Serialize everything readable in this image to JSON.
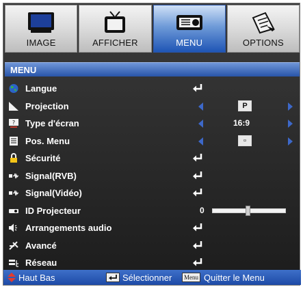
{
  "tabs": [
    {
      "label": "IMAGE",
      "icon": "monitor-icon",
      "active": false
    },
    {
      "label": "AFFICHER",
      "icon": "tv-icon",
      "active": false
    },
    {
      "label": "MENU",
      "icon": "projector-icon",
      "active": true
    },
    {
      "label": "OPTIONS",
      "icon": "settings-icon",
      "active": false
    }
  ],
  "section_title": "MENU",
  "rows": [
    {
      "label": "Langue",
      "icon": "globe-icon",
      "control": "enter"
    },
    {
      "label": "Projection",
      "icon": "projection-icon",
      "control": "arrows",
      "value": "P"
    },
    {
      "label": "Type d'écran",
      "icon": "screen-type-icon",
      "control": "arrows",
      "value": "16:9"
    },
    {
      "label": "Pos. Menu",
      "icon": "menu-position-icon",
      "control": "arrows",
      "value": "▫"
    },
    {
      "label": "Sécurité",
      "icon": "lock-icon",
      "control": "enter"
    },
    {
      "label": "Signal(RVB)",
      "icon": "signal-icon",
      "control": "enter"
    },
    {
      "label": "Signal(Vidéo)",
      "icon": "signal-icon",
      "control": "enter"
    },
    {
      "label": "ID Projecteur",
      "icon": "projector-id-icon",
      "control": "slider",
      "value": "0",
      "level": 0.48
    },
    {
      "label": "Arrangements audio",
      "icon": "speaker-icon",
      "control": "enter"
    },
    {
      "label": "Avancé",
      "icon": "advanced-icon",
      "control": "enter"
    },
    {
      "label": "Réseau",
      "icon": "network-icon",
      "control": "enter"
    }
  ],
  "footer": {
    "nav_text": "Haut Bas",
    "select_text": "Sélectionner",
    "menu_key": "Menu",
    "quit_text": "Quitter le Menu"
  },
  "colors": {
    "accent": "#2854a8",
    "active_tab": "#1f55b5",
    "arrow": "#3d68c9",
    "background": "#2a2a2a"
  }
}
